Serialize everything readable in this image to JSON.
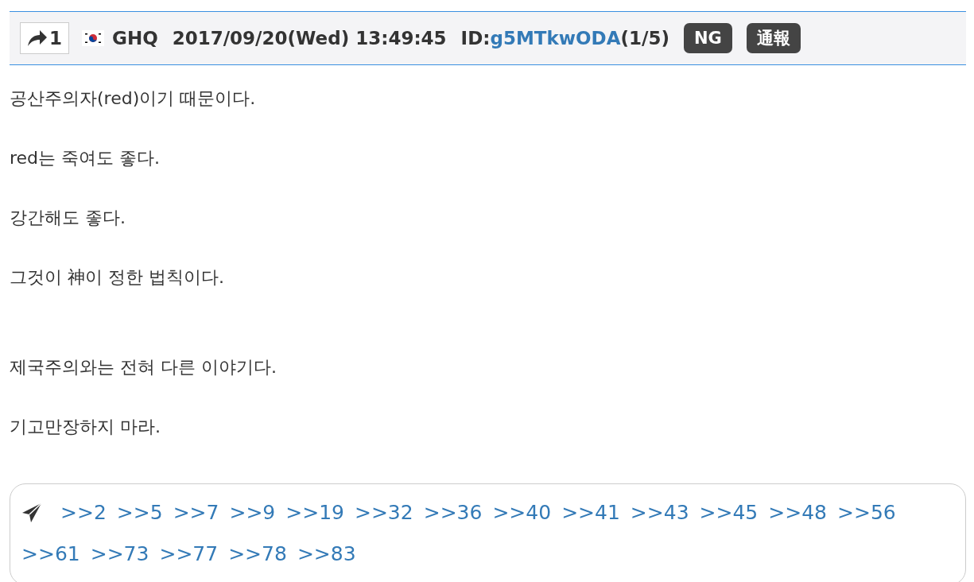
{
  "post_header": {
    "reply_count": "1",
    "name": "GHQ",
    "datetime": "2017/09/20(Wed) 13:49:45",
    "id_label": "ID:",
    "id": "g5MTkwODA",
    "id_count": "(1/5)",
    "buttons": [
      "NG",
      "通報"
    ]
  },
  "body": [
    [
      "공산주의자(red)이기 때문이다.",
      "red는 죽여도 좋다.",
      "강간해도 좋다.",
      "그것이 神이 정한 법칙이다."
    ],
    [
      "제국주의와는 전혀 다른 이야기다.",
      "기고만장하지 마라."
    ]
  ],
  "replies": [
    ">>2",
    ">>5",
    ">>7",
    ">>9",
    ">>19",
    ">>32",
    ">>36",
    ">>40",
    ">>41",
    ">>43",
    ">>45",
    ">>48",
    ">>56",
    ">>61",
    ">>73",
    ">>77",
    ">>78",
    ">>83"
  ]
}
